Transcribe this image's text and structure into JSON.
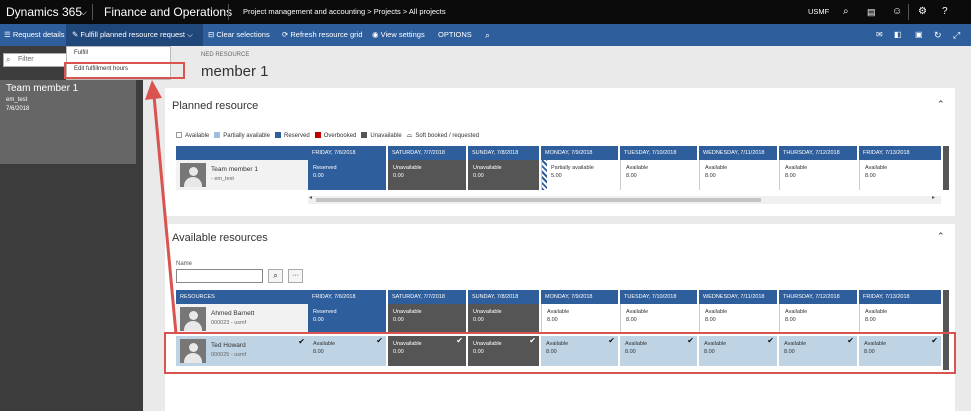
{
  "topbar": {
    "app": "Dynamics 365",
    "module": "Finance and Operations",
    "breadcrumb": "Project management and accounting  >  Projects  >  All projects",
    "company": "USMF"
  },
  "actionbar": {
    "request_details": "Request details",
    "fulfill": "Fulfill planned resource request",
    "clear": "Clear selections",
    "refresh": "Refresh resource grid",
    "view": "View settings",
    "options": "OPTIONS"
  },
  "dropdown": {
    "items": [
      "Fulfill",
      "Edit fulfillment hours"
    ]
  },
  "sidebar": {
    "filter_placeholder": "Filter",
    "card_title": "Team member 1",
    "card_sub1": "em_test",
    "card_sub2": "7/6/2018"
  },
  "page": {
    "caption": "NED RESOURCE",
    "title": "member 1"
  },
  "planned": {
    "title": "Planned resource",
    "legend": [
      "Available",
      "Partially available",
      "Reserved",
      "Overbooked",
      "Unavailable",
      "Soft booked / requested"
    ],
    "dates": [
      "FRIDAY, 7/6/2018",
      "SATURDAY, 7/7/2018",
      "SUNDAY, 7/8/2018",
      "MONDAY, 7/9/2018",
      "TUESDAY, 7/10/2018",
      "WEDNESDAY, 7/11/2018",
      "THURSDAY, 7/12/2018",
      "FRIDAY, 7/13/2018"
    ],
    "person": {
      "name": "Team member 1",
      "sub": "- em_test"
    },
    "cells": [
      [
        "Reserved",
        "0.00"
      ],
      [
        "Unavailable",
        "0.00"
      ],
      [
        "Unavailable",
        "0.00"
      ],
      [
        "Partially available",
        "5.00"
      ],
      [
        "Available",
        "8.00"
      ],
      [
        "Available",
        "8.00"
      ],
      [
        "Available",
        "8.00"
      ],
      [
        "Available",
        "8.00"
      ]
    ]
  },
  "available": {
    "title": "Available resources",
    "name_label": "Name",
    "res_header": "RESOURCES",
    "dates": [
      "FRIDAY, 7/6/2018",
      "SATURDAY, 7/7/2018",
      "SUNDAY, 7/8/2018",
      "MONDAY, 7/9/2018",
      "TUESDAY, 7/10/2018",
      "WEDNESDAY, 7/11/2018",
      "THURSDAY, 7/12/2018",
      "FRIDAY, 7/13/2018"
    ],
    "rows": [
      {
        "name": "Ahmed Barnett",
        "sub": "000023 - usmf",
        "cells": [
          [
            "Reserved",
            "0.00"
          ],
          [
            "Unavailable",
            "0.00"
          ],
          [
            "Unavailable",
            "0.00"
          ],
          [
            "Available",
            "8.00"
          ],
          [
            "Available",
            "8.00"
          ],
          [
            "Available",
            "8.00"
          ],
          [
            "Available",
            "8.00"
          ],
          [
            "Available",
            "8.00"
          ]
        ]
      },
      {
        "name": "Ted Howard",
        "sub": "000025 - usmf",
        "cells": [
          [
            "Available",
            "8.00"
          ],
          [
            "Unavailable",
            "0.00"
          ],
          [
            "Unavailable",
            "0.00"
          ],
          [
            "Available",
            "8.00"
          ],
          [
            "Available",
            "8.00"
          ],
          [
            "Available",
            "8.00"
          ],
          [
            "Available",
            "8.00"
          ],
          [
            "Available",
            "8.00"
          ]
        ]
      }
    ]
  },
  "colors": {
    "brand": "#2e5e9c",
    "highlight": "#d9534f",
    "unavailable": "#555555",
    "overbooked": "#c00000"
  }
}
